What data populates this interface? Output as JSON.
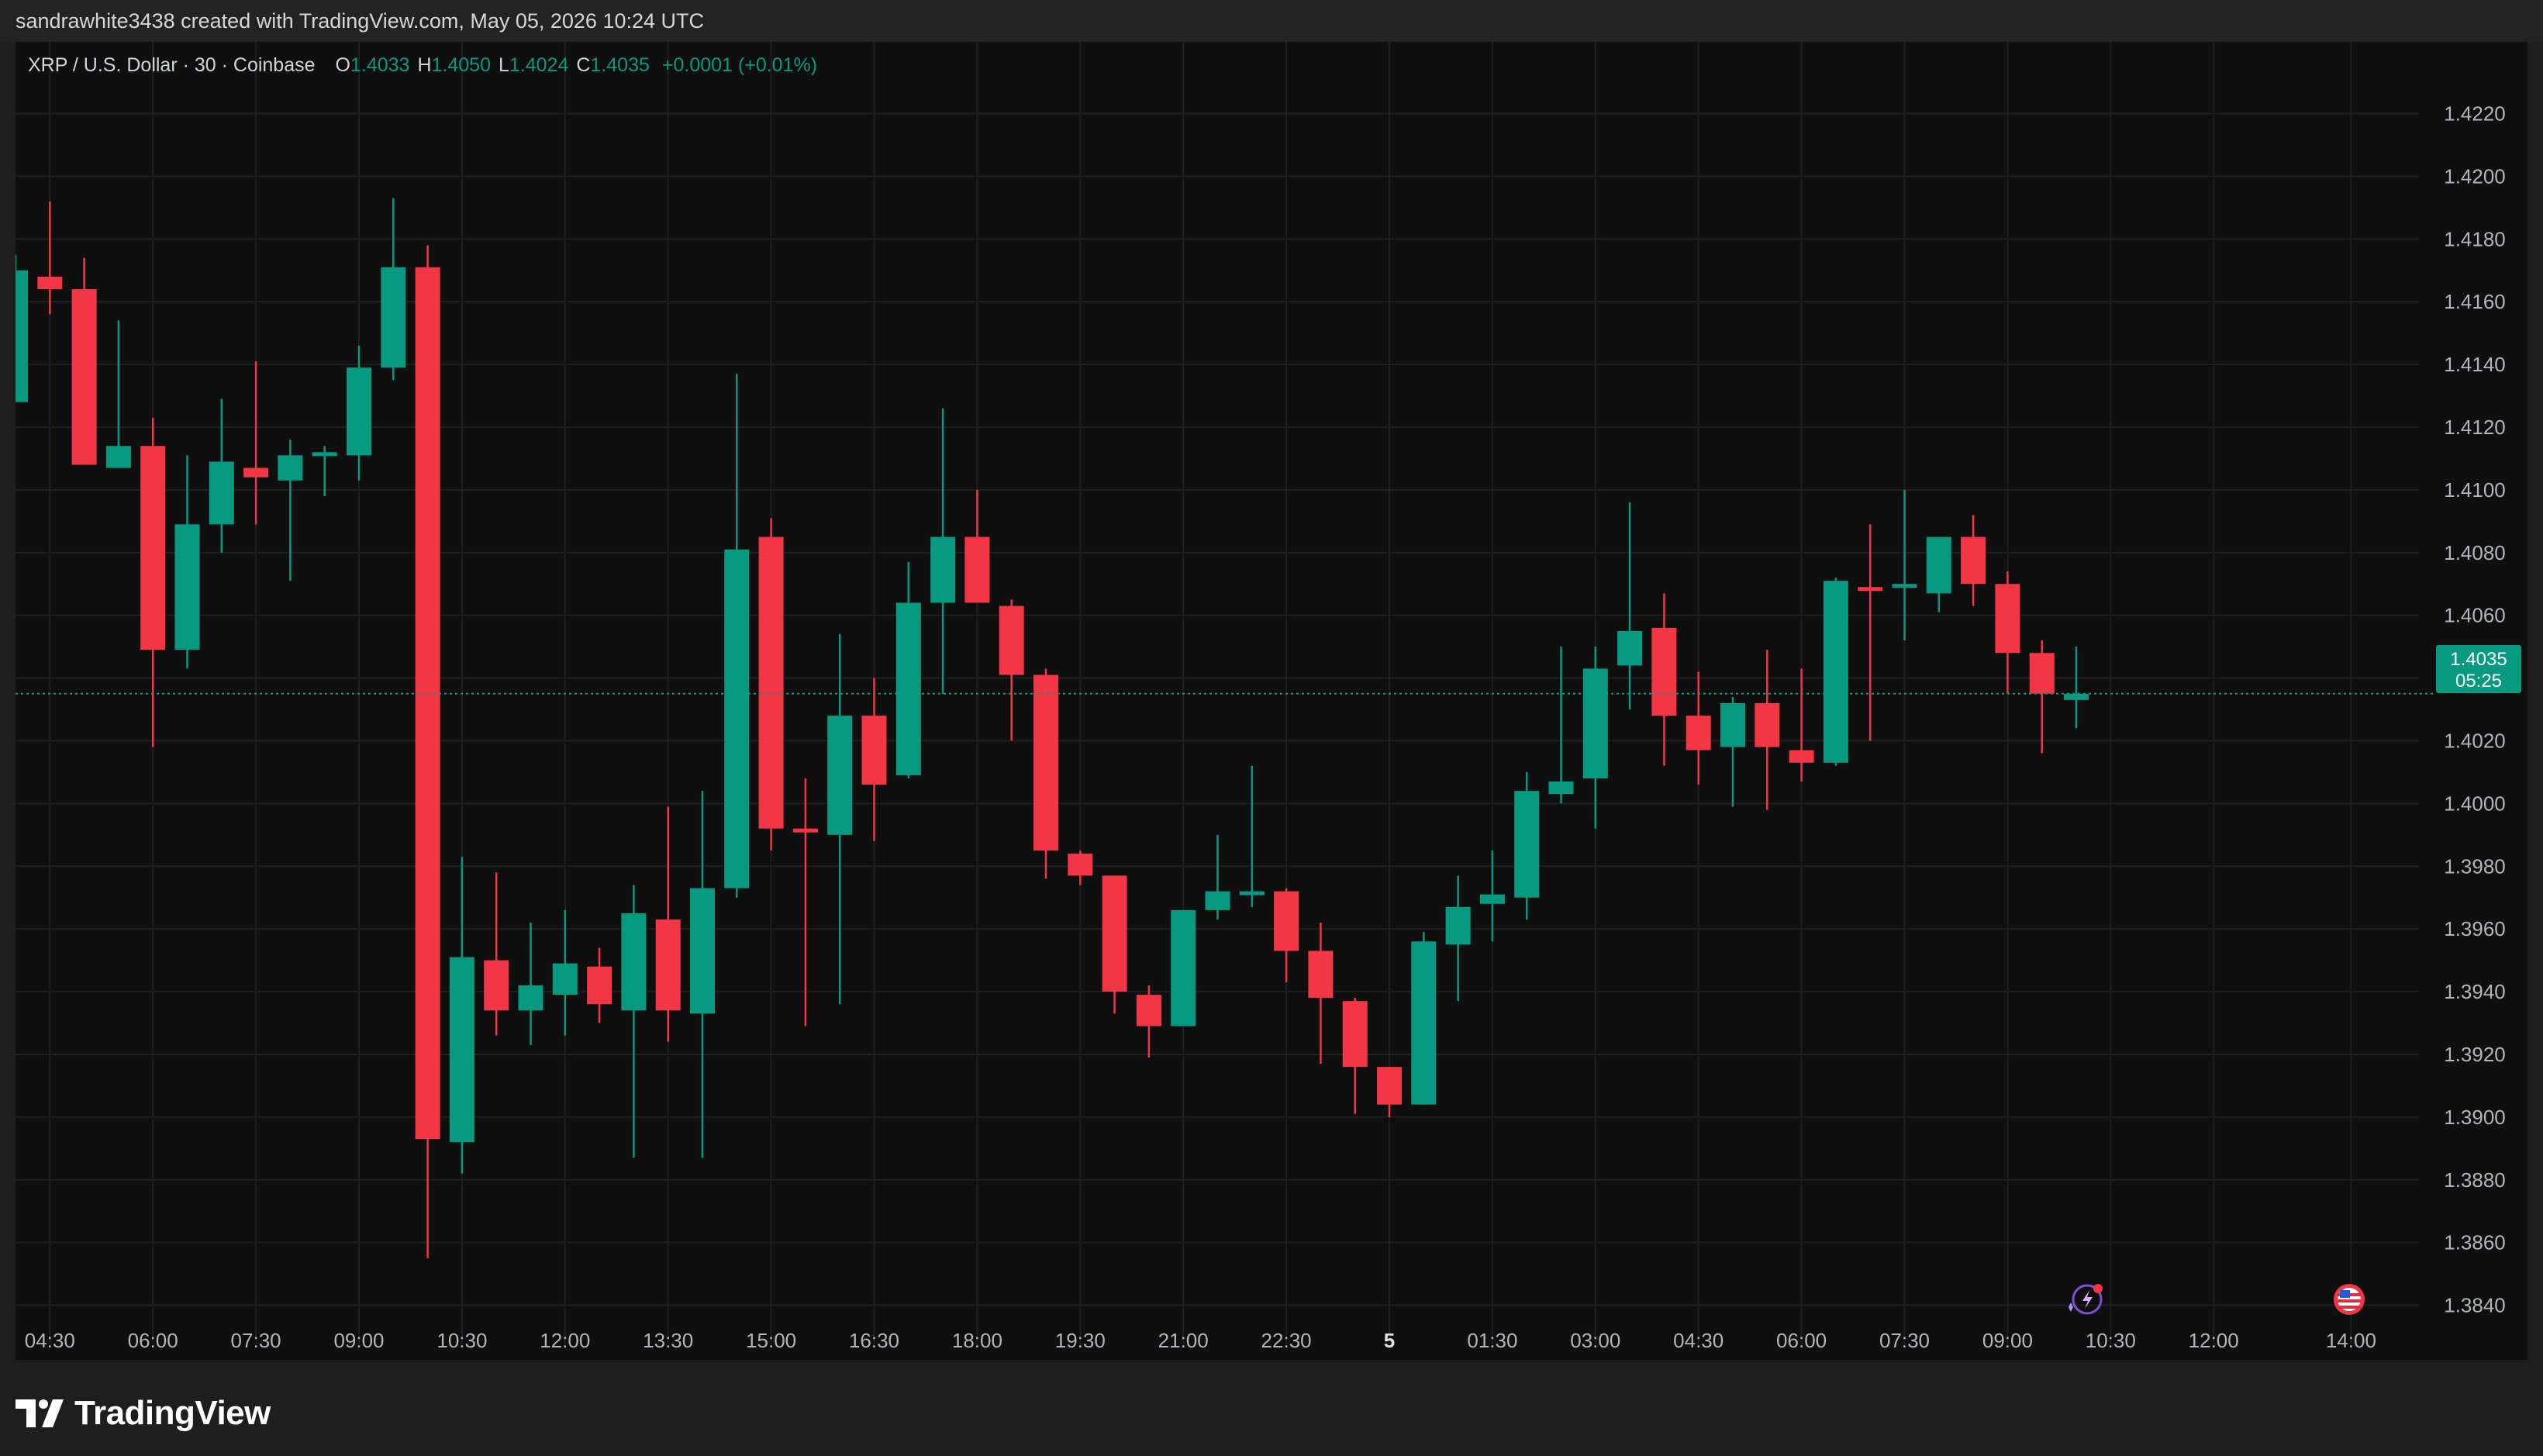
{
  "header": {
    "created_text": "sandrawhite3438 created with TradingView.com, May 05, 2026 10:24 UTC"
  },
  "legend": {
    "symbol": "XRP / U.S. Dollar · 30 · Coinbase",
    "open_label": "O",
    "open": "1.4033",
    "high_label": "H",
    "high": "1.4050",
    "low_label": "L",
    "low": "1.4024",
    "close_label": "C",
    "close": "1.4035",
    "change": "+0.0001 (+0.01%)"
  },
  "price_tag": {
    "price": "1.4035",
    "countdown": "05:25"
  },
  "footer": {
    "brand": "TradingView"
  },
  "colors": {
    "up": "#089981",
    "down": "#f23645",
    "background": "#0f0f0f",
    "grid": "#1f1f1f",
    "axis_text": "#b2b5be"
  },
  "icons": [
    "tv-logo-icon",
    "sparkle-bolt-icon",
    "us-flag-icon"
  ],
  "chart_data": {
    "type": "candlestick",
    "title": "XRP / U.S. Dollar · 30 · Coinbase",
    "interval": "30",
    "ylim": [
      1.383,
      1.423
    ],
    "y_ticks": [
      "1.4220",
      "1.4200",
      "1.4180",
      "1.4160",
      "1.4140",
      "1.4120",
      "1.4100",
      "1.4080",
      "1.4060",
      "1.4040",
      "1.4020",
      "1.4000",
      "1.3980",
      "1.3960",
      "1.3940",
      "1.3920",
      "1.3900",
      "1.3880",
      "1.3860",
      "1.3840"
    ],
    "x_tick_labels": [
      {
        "label": "04:30",
        "bar": 1
      },
      {
        "label": "06:00",
        "bar": 4
      },
      {
        "label": "07:30",
        "bar": 7
      },
      {
        "label": "09:00",
        "bar": 10
      },
      {
        "label": "10:30",
        "bar": 13
      },
      {
        "label": "12:00",
        "bar": 16
      },
      {
        "label": "13:30",
        "bar": 19
      },
      {
        "label": "15:00",
        "bar": 22
      },
      {
        "label": "16:30",
        "bar": 25
      },
      {
        "label": "18:00",
        "bar": 28
      },
      {
        "label": "19:30",
        "bar": 31
      },
      {
        "label": "21:00",
        "bar": 34
      },
      {
        "label": "22:30",
        "bar": 37
      },
      {
        "label": "5",
        "bar": 40
      },
      {
        "label": "01:30",
        "bar": 43
      },
      {
        "label": "03:00",
        "bar": 46
      },
      {
        "label": "04:30",
        "bar": 49
      },
      {
        "label": "06:00",
        "bar": 52
      },
      {
        "label": "07:30",
        "bar": 55
      },
      {
        "label": "09:00",
        "bar": 58
      },
      {
        "label": "10:30",
        "bar": 61
      },
      {
        "label": "12:00",
        "bar": 64
      },
      {
        "label": "14:00",
        "bar": 68
      }
    ],
    "candles": [
      [
        1.4128,
        1.4175,
        1.4128,
        1.417
      ],
      [
        1.4168,
        1.4192,
        1.4156,
        1.4164
      ],
      [
        1.4164,
        1.4174,
        1.4108,
        1.4108
      ],
      [
        1.4107,
        1.4154,
        1.4107,
        1.4114
      ],
      [
        1.4114,
        1.4123,
        1.4018,
        1.4049
      ],
      [
        1.4049,
        1.4111,
        1.4043,
        1.4089
      ],
      [
        1.4089,
        1.4129,
        1.408,
        1.4109
      ],
      [
        1.4107,
        1.4141,
        1.4089,
        1.4104
      ],
      [
        1.4103,
        1.4116,
        1.4071,
        1.4111
      ],
      [
        1.4111,
        1.4114,
        1.4098,
        1.4112
      ],
      [
        1.4111,
        1.4146,
        1.4103,
        1.4139
      ],
      [
        1.4139,
        1.4193,
        1.4135,
        1.4171
      ],
      [
        1.4171,
        1.4178,
        1.3855,
        1.3893
      ],
      [
        1.3892,
        1.3983,
        1.3882,
        1.3951
      ],
      [
        1.395,
        1.3978,
        1.3926,
        1.3934
      ],
      [
        1.3934,
        1.3962,
        1.3923,
        1.3942
      ],
      [
        1.3939,
        1.3966,
        1.3926,
        1.3949
      ],
      [
        1.3948,
        1.3954,
        1.393,
        1.3936
      ],
      [
        1.3934,
        1.3974,
        1.3887,
        1.3965
      ],
      [
        1.3963,
        1.3999,
        1.3924,
        1.3934
      ],
      [
        1.3933,
        1.4004,
        1.3887,
        1.3973
      ],
      [
        1.3973,
        1.4137,
        1.397,
        1.4081
      ],
      [
        1.4085,
        1.4091,
        1.3985,
        1.3992
      ],
      [
        1.3992,
        1.4008,
        1.3929,
        1.3991
      ],
      [
        1.399,
        1.4054,
        1.3936,
        1.4028
      ],
      [
        1.4028,
        1.404,
        1.3988,
        1.4006
      ],
      [
        1.4009,
        1.4077,
        1.4008,
        1.4064
      ],
      [
        1.4064,
        1.4126,
        1.4035,
        1.4085
      ],
      [
        1.4085,
        1.41,
        1.4065,
        1.4064
      ],
      [
        1.4063,
        1.4065,
        1.402,
        1.4041
      ],
      [
        1.4041,
        1.4043,
        1.3976,
        1.3985
      ],
      [
        1.3984,
        1.3985,
        1.3974,
        1.3977
      ],
      [
        1.3977,
        1.3977,
        1.3933,
        1.394
      ],
      [
        1.3939,
        1.3942,
        1.3919,
        1.3929
      ],
      [
        1.3929,
        1.3966,
        1.3929,
        1.3966
      ],
      [
        1.3966,
        1.399,
        1.3963,
        1.3972
      ],
      [
        1.3971,
        1.4012,
        1.3967,
        1.3972
      ],
      [
        1.3972,
        1.3973,
        1.3943,
        1.3953
      ],
      [
        1.3953,
        1.3962,
        1.3917,
        1.3938
      ],
      [
        1.3937,
        1.3938,
        1.3901,
        1.3916
      ],
      [
        1.3916,
        1.3916,
        1.39,
        1.3904
      ],
      [
        1.3904,
        1.3959,
        1.3904,
        1.3956
      ],
      [
        1.3955,
        1.3977,
        1.3937,
        1.3967
      ],
      [
        1.3968,
        1.3985,
        1.3956,
        1.3971
      ],
      [
        1.397,
        1.401,
        1.3963,
        1.4004
      ],
      [
        1.4003,
        1.405,
        1.4,
        1.4007
      ],
      [
        1.4008,
        1.405,
        1.3992,
        1.4043
      ],
      [
        1.4044,
        1.4096,
        1.403,
        1.4055
      ],
      [
        1.4056,
        1.4067,
        1.4012,
        1.4028
      ],
      [
        1.4028,
        1.4042,
        1.4006,
        1.4017
      ],
      [
        1.4018,
        1.4034,
        1.3999,
        1.4032
      ],
      [
        1.4032,
        1.4049,
        1.3998,
        1.4018
      ],
      [
        1.4017,
        1.4043,
        1.4007,
        1.4013
      ],
      [
        1.4013,
        1.4072,
        1.4012,
        1.4071
      ],
      [
        1.4069,
        1.4089,
        1.402,
        1.4068
      ],
      [
        1.4069,
        1.41,
        1.4052,
        1.407
      ],
      [
        1.4067,
        1.4085,
        1.4061,
        1.4085
      ],
      [
        1.4085,
        1.4092,
        1.4063,
        1.407
      ],
      [
        1.407,
        1.4074,
        1.4035,
        1.4048
      ],
      [
        1.4048,
        1.4052,
        1.4016,
        1.4035
      ],
      [
        1.4033,
        1.405,
        1.4024,
        1.4035
      ]
    ]
  }
}
